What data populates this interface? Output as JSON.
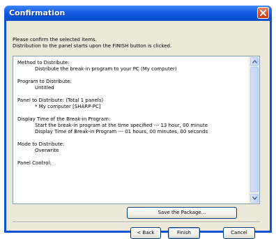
{
  "window": {
    "title": "Confirmation"
  },
  "intro": {
    "line1": "Please confirm the selected items.",
    "line2": "Distribution to the panel starts upon the FINISH button is clicked."
  },
  "list": {
    "items": [
      {
        "heading": "Method to Distribute:",
        "lines": [
          "Distribute the break-in program to your PC (My computer)"
        ]
      },
      {
        "heading": "Program to Distribute:",
        "lines": [
          "Untitled"
        ]
      },
      {
        "heading": "Panel to Distribute:  (Total 1 panels)",
        "lines": [
          "* My computer [SHARP-PC]"
        ]
      },
      {
        "heading": "Display Time of the Break-in Program:",
        "lines": [
          "Start the break-in program at the time specified --- 13 hour, 00 minute",
          "Display Time of Break-in Program --- 01 hours, 00 minutes, 00 seconds"
        ]
      },
      {
        "heading": "Mode to Distribute:",
        "lines": [
          "Overwrite"
        ]
      },
      {
        "heading": "Panel Control:",
        "lines": []
      }
    ]
  },
  "buttons": {
    "save": "Save the Package...",
    "back": "< Back",
    "finish": "Finish",
    "cancel": "Cancel"
  },
  "icons": {
    "close": "close-icon",
    "scroll_up": "chevron-up-icon",
    "scroll_down": "chevron-down-icon"
  },
  "colors": {
    "titlebar": "#0a53d8",
    "close_button": "#d84c22",
    "client_background": "#ece9d8"
  }
}
